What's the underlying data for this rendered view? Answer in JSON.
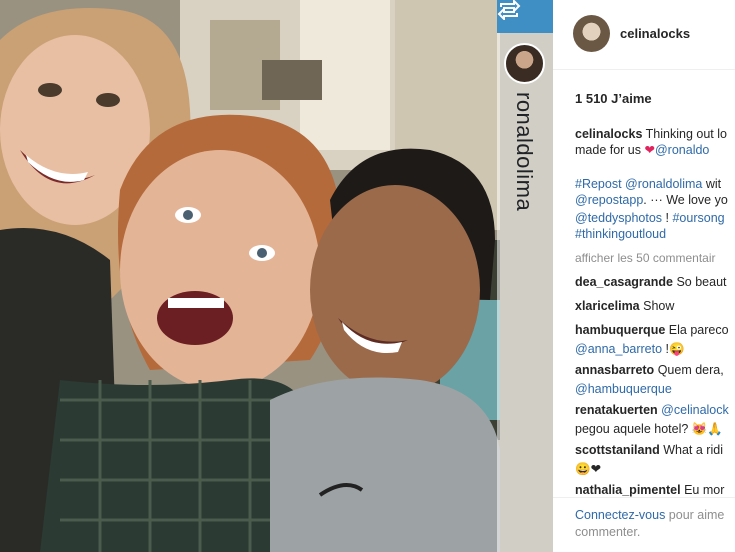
{
  "repost_strip": {
    "username": "ronaldolima"
  },
  "post": {
    "author": "celinalocks",
    "likes": "1 510 J’aime",
    "caption": {
      "author": "celinalocks",
      "text_1": "Thinking out lo",
      "text_2": "made for us",
      "mention": "@ronaldo"
    },
    "repost_lines": [
      {
        "parts": [
          {
            "t": "#Repost @ronaldolima",
            "c": "link"
          },
          {
            "t": " wit",
            "c": ""
          }
        ]
      },
      {
        "parts": [
          {
            "t": "@repostapp",
            "c": "link"
          },
          {
            "t": ". ··· We love yo",
            "c": ""
          }
        ]
      },
      {
        "parts": [
          {
            "t": "@teddysphotos",
            "c": "link"
          },
          {
            "t": " ! ",
            "c": ""
          },
          {
            "t": "#oursong",
            "c": "link"
          }
        ]
      },
      {
        "parts": [
          {
            "t": "#thinkingoutloud",
            "c": "link"
          }
        ]
      }
    ],
    "view_all_comments": "afficher les 50 commentair",
    "comments": [
      {
        "user": "dea_casagrande",
        "text": "So beaut"
      },
      {
        "user": "xlaricelima",
        "text": "Show"
      },
      {
        "user": "hambuquerque",
        "text": "Ela pareco",
        "line2_link": "@anna_barreto",
        "line2_text": " !😜"
      },
      {
        "user": "annasbarreto",
        "text": "Quem dera,",
        "line2_link": "@hambuquerque",
        "line2_text": ""
      },
      {
        "user": "renatakuerten",
        "text": "",
        "link": "@celinalock",
        "line2_text": "pegou aquele hotel? 😻🙏"
      },
      {
        "user": "scottstaniland",
        "text": "What a ridi",
        "line2_text": "😀❤"
      },
      {
        "user": "nathalia_pimentel",
        "text": "Eu mor"
      }
    ],
    "login_link": "Connectez-vous",
    "login_text": " pour aime",
    "login_text_2": "commenter."
  },
  "icons": {
    "repost": "repost-icon",
    "heart": "heart-icon"
  },
  "colors": {
    "repost_bar": "#3f8fc4",
    "link": "#2f6aa8",
    "heart": "#e0245e"
  }
}
